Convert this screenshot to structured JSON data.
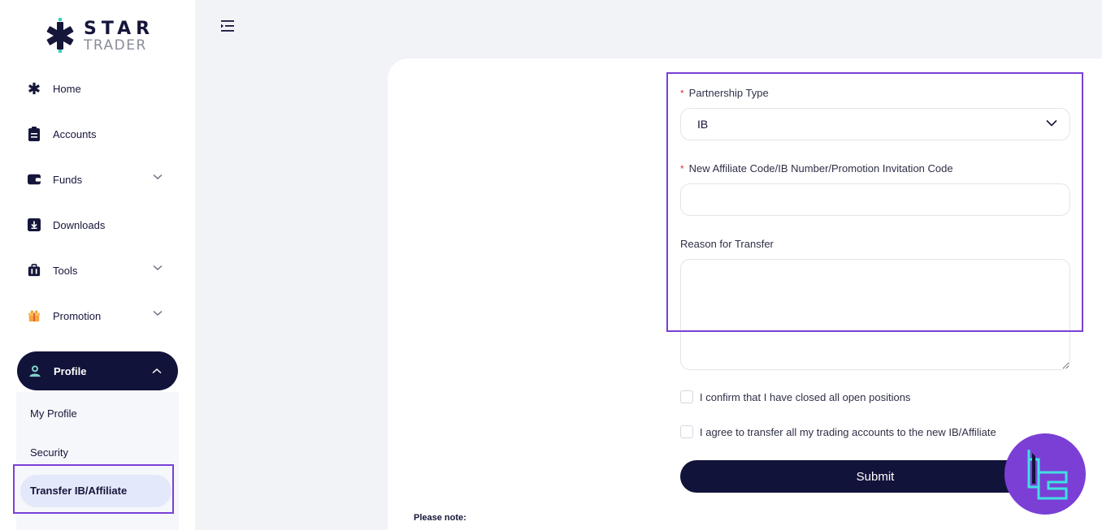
{
  "brand": {
    "name_top": "STAR",
    "name_bottom": "TRADER",
    "accent": "#2bd4c8",
    "dark": "#15163a",
    "highlight": "#7b3fd6"
  },
  "sidebar": {
    "items": [
      {
        "label": "Home",
        "icon": "home-icon"
      },
      {
        "label": "Accounts",
        "icon": "accounts-icon"
      },
      {
        "label": "Funds",
        "icon": "wallet-icon",
        "expandable": true
      },
      {
        "label": "Downloads",
        "icon": "download-icon"
      },
      {
        "label": "Tools",
        "icon": "toolbox-icon",
        "expandable": true
      },
      {
        "label": "Promotion",
        "icon": "gift-icon",
        "expandable": true
      },
      {
        "label": "Profile",
        "icon": "user-icon",
        "expandable": true,
        "active": true
      }
    ],
    "profile_submenu": [
      {
        "label": "My Profile"
      },
      {
        "label": "Security"
      },
      {
        "label": "Transfer IB/Affiliate",
        "active": true
      }
    ]
  },
  "form": {
    "partnership_label": "Partnership Type",
    "partnership_value": "IB",
    "affiliate_label": "New Affiliate Code/IB Number/Promotion Invitation Code",
    "affiliate_value": "",
    "reason_label": "Reason for Transfer",
    "reason_value": "",
    "confirm_closed": "I confirm that I have closed all open positions",
    "agree_transfer": "I agree to transfer all my trading accounts to the new IB/Affiliate",
    "submit_label": "Submit",
    "required_mark": "*"
  },
  "note": "Please note:"
}
